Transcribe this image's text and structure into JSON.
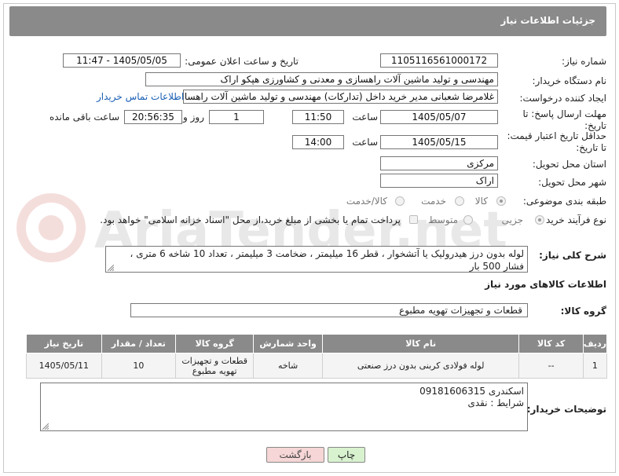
{
  "header": {
    "title": "جزئیات اطلاعات نیاز"
  },
  "fields": {
    "need_number_label": "شماره نیاز:",
    "need_number": "1105116561000172",
    "announce_label": "تاریخ و ساعت اعلان عمومی:",
    "announce_value": "1405/05/05 - 11:47",
    "buyer_org_label": "نام دستگاه خریدار:",
    "buyer_org": "مهندسی و تولید ماشین آلات راهسازی و معدنی و کشاورزی هپکو اراک",
    "requester_label": "ایجاد کننده درخواست:",
    "requester": "غلامرضا شعبانی مدیر خرید داخل (تدارکات) مهندسی و تولید ماشین آلات راهسا",
    "contact_link": "اطلاعات تماس خریدار",
    "deadline_label": "مهلت ارسال پاسخ: تا تاریخ:",
    "deadline_date": "1405/05/07",
    "time_label": "ساعت",
    "deadline_time": "11:50",
    "days_value": "1",
    "days_label": "روز و",
    "remaining_time": "20:56:35",
    "remaining_label": "ساعت باقی مانده",
    "validity_label": "حداقل تاریخ اعتبار قیمت: تا تاریخ:",
    "validity_date": "1405/05/15",
    "validity_time": "14:00",
    "province_label": "استان محل تحویل:",
    "province": "مرکزی",
    "city_label": "شهر محل تحویل:",
    "city": "اراک",
    "category_label": "طبقه بندی موضوعی:",
    "category_options": [
      "کالا",
      "خدمت",
      "کالا/خدمت"
    ],
    "category_selected": "کالا",
    "process_label": "نوع فرآیند خرید :",
    "process_options": [
      "جزیی",
      "متوسط"
    ],
    "process_selected": "جزیی",
    "payment_note": "پرداخت تمام یا بخشی از مبلغ خرید،از محل \"اسناد خزانه اسلامی\" خواهد بود."
  },
  "description": {
    "label": "شرح کلی نیاز:",
    "text": "لوله بدون درز هیدرولیک یا آتشخوار ، قطر 16 میلیمتر ، ضخامت 3 میلیمتر ، تعداد 10 شاخه 6 متری ، فشار 500 بار"
  },
  "goods_section": {
    "title": "اطلاعات کالاهای مورد نیاز",
    "group_label": "گروه کالا:",
    "group_value": "قطعات و تجهیزات تهویه مطبوع"
  },
  "table": {
    "headers": [
      "ردیف",
      "کد کالا",
      "نام کالا",
      "واحد شمارش",
      "گروه کالا",
      "تعداد / مقدار",
      "تاریخ نیاز"
    ],
    "rows": [
      [
        "1",
        "--",
        "لوله فولادی کربنی بدون درز صنعتی",
        "شاخه",
        "قطعات و تجهیزات تهویه مطبوع",
        "10",
        "1405/05/11"
      ]
    ]
  },
  "notes": {
    "label": "توضیحات خریدار:",
    "line1": "اسکندری 09181606315",
    "line2": "شرایط : نقدی"
  },
  "buttons": {
    "print": "چاپ",
    "back": "بازگشت"
  },
  "watermark": "AriaTender.net",
  "colors": {
    "header_bg": "#8a8a8a",
    "link": "#1a5fb4",
    "back_btn": "#f6d6d6",
    "print_btn": "#d8f2cf"
  }
}
